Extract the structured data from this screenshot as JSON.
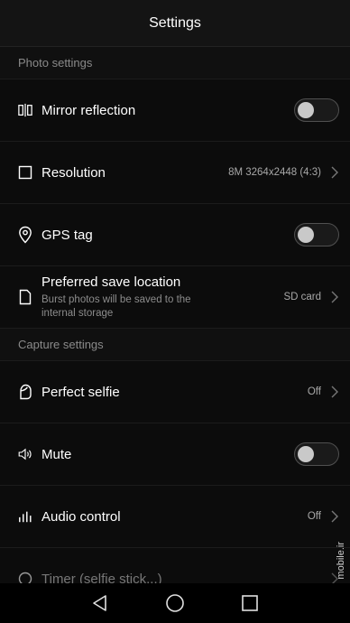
{
  "header": {
    "title": "Settings"
  },
  "sections": {
    "photo": {
      "label": "Photo settings"
    },
    "capture": {
      "label": "Capture settings"
    }
  },
  "rows": {
    "mirror": {
      "title": "Mirror reflection",
      "icon": "mirror-icon",
      "toggle": false
    },
    "resolution": {
      "title": "Resolution",
      "icon": "resolution-icon",
      "value": "8M 3264x2448 (4:3)"
    },
    "gps": {
      "title": "GPS tag",
      "icon": "location-pin-icon",
      "toggle": false
    },
    "save_location": {
      "title": "Preferred save location",
      "subtitle": "Burst photos will be saved to the internal storage",
      "icon": "file-icon",
      "value": "SD card"
    },
    "perfect_selfie": {
      "title": "Perfect selfie",
      "icon": "face-icon",
      "value": "Off"
    },
    "mute": {
      "title": "Mute",
      "icon": "speaker-icon",
      "toggle": false
    },
    "audio_control": {
      "title": "Audio control",
      "icon": "audio-bars-icon",
      "value": "Off"
    },
    "timer": {
      "title": "Timer (selfie stick...)",
      "icon": "timer-icon",
      "value": ""
    }
  },
  "navbar": {
    "back": "back-icon",
    "home": "home-icon",
    "recents": "recents-icon"
  },
  "watermark": "mobile.ir",
  "colors": {
    "background": "#000000",
    "text": "#ffffff",
    "secondary": "#8a8a8a"
  }
}
